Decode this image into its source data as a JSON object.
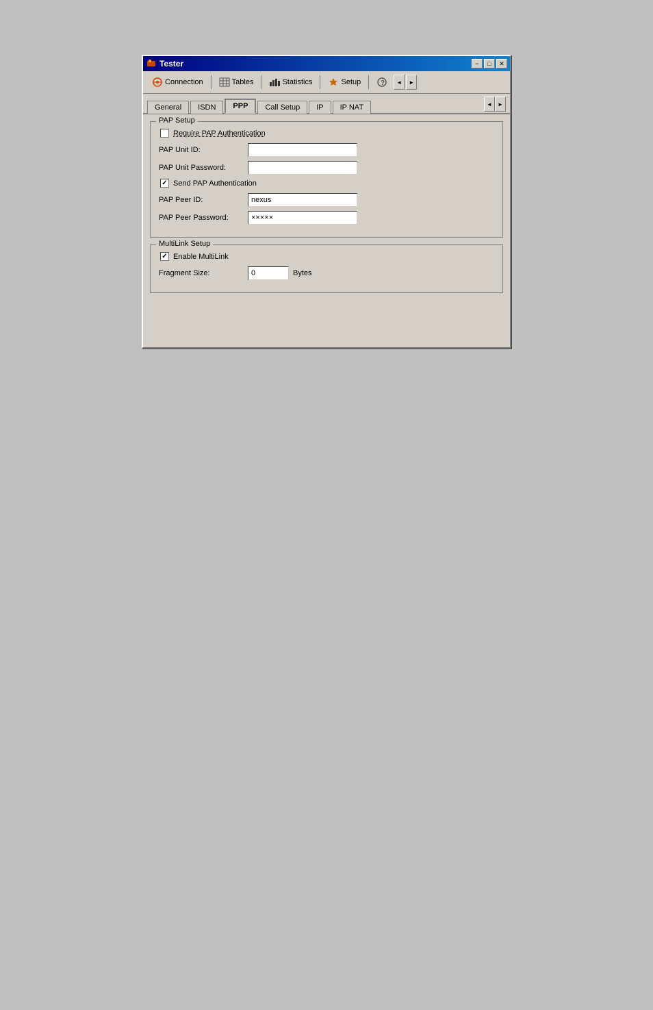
{
  "window": {
    "title": "Tester",
    "min_btn": "−",
    "max_btn": "□",
    "close_btn": "✕"
  },
  "toolbar": {
    "connection_label": "Connection",
    "tables_label": "Tables",
    "statistics_label": "Statistics",
    "setup_label": "Setup"
  },
  "tabs": {
    "general_label": "General",
    "isdn_label": "ISDN",
    "ppp_label": "PPP",
    "call_setup_label": "Call Setup",
    "ip_label": "IP",
    "ip_nat_label": "IP NAT"
  },
  "pap_setup": {
    "group_title": "PAP Setup",
    "require_pap_label": "Require PAP Authentication",
    "require_pap_checked": false,
    "pap_unit_id_label": "PAP Unit ID:",
    "pap_unit_id_value": "",
    "pap_unit_password_label": "PAP Unit Password:",
    "pap_unit_password_value": "",
    "send_pap_label": "Send PAP Authentication",
    "send_pap_checked": true,
    "pap_peer_id_label": "PAP Peer ID:",
    "pap_peer_id_value": "nexus",
    "pap_peer_password_label": "PAP Peer Password:",
    "pap_peer_password_value": "×××××"
  },
  "multilink_setup": {
    "group_title": "MultiLink Setup",
    "enable_label": "Enable MultiLink",
    "enable_checked": true,
    "fragment_size_label": "Fragment Size:",
    "fragment_size_value": "0",
    "bytes_label": "Bytes"
  }
}
